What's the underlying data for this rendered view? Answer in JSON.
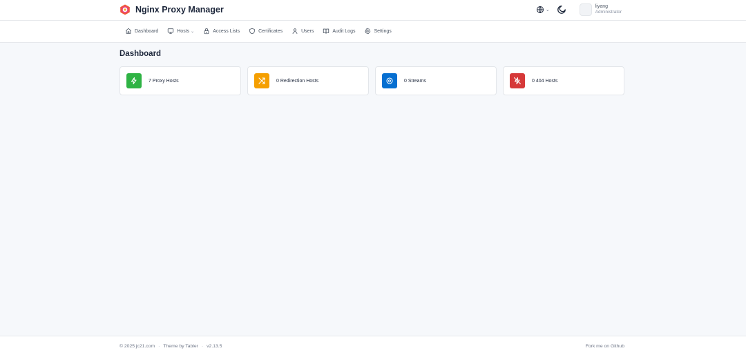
{
  "header": {
    "title": "Nginx Proxy Manager",
    "user": {
      "name": "liyang",
      "role": "Administrator"
    }
  },
  "nav": {
    "items": [
      {
        "label": "Dashboard",
        "icon": "home-icon"
      },
      {
        "label": "Hosts",
        "icon": "monitor-icon",
        "has_dropdown": true
      },
      {
        "label": "Access Lists",
        "icon": "lock-icon"
      },
      {
        "label": "Certificates",
        "icon": "shield-icon"
      },
      {
        "label": "Users",
        "icon": "user-icon"
      },
      {
        "label": "Audit Logs",
        "icon": "book-icon"
      },
      {
        "label": "Settings",
        "icon": "gear-icon"
      }
    ]
  },
  "main": {
    "title": "Dashboard",
    "cards": [
      {
        "label": "7 Proxy Hosts",
        "icon": "bolt-icon",
        "color": "#2fb344"
      },
      {
        "label": "0 Redirection Hosts",
        "icon": "shuffle-icon",
        "color": "#f59f00"
      },
      {
        "label": "0 Streams",
        "icon": "stream-icon",
        "color": "#066fd1"
      },
      {
        "label": "0 404 Hosts",
        "icon": "bolt-off-icon",
        "color": "#d63939"
      }
    ]
  },
  "footer": {
    "copyright": "© 2025 jc21.com",
    "theme": "Theme by Tabler",
    "version": "v2.13.5",
    "github": "Fork me on Github"
  }
}
